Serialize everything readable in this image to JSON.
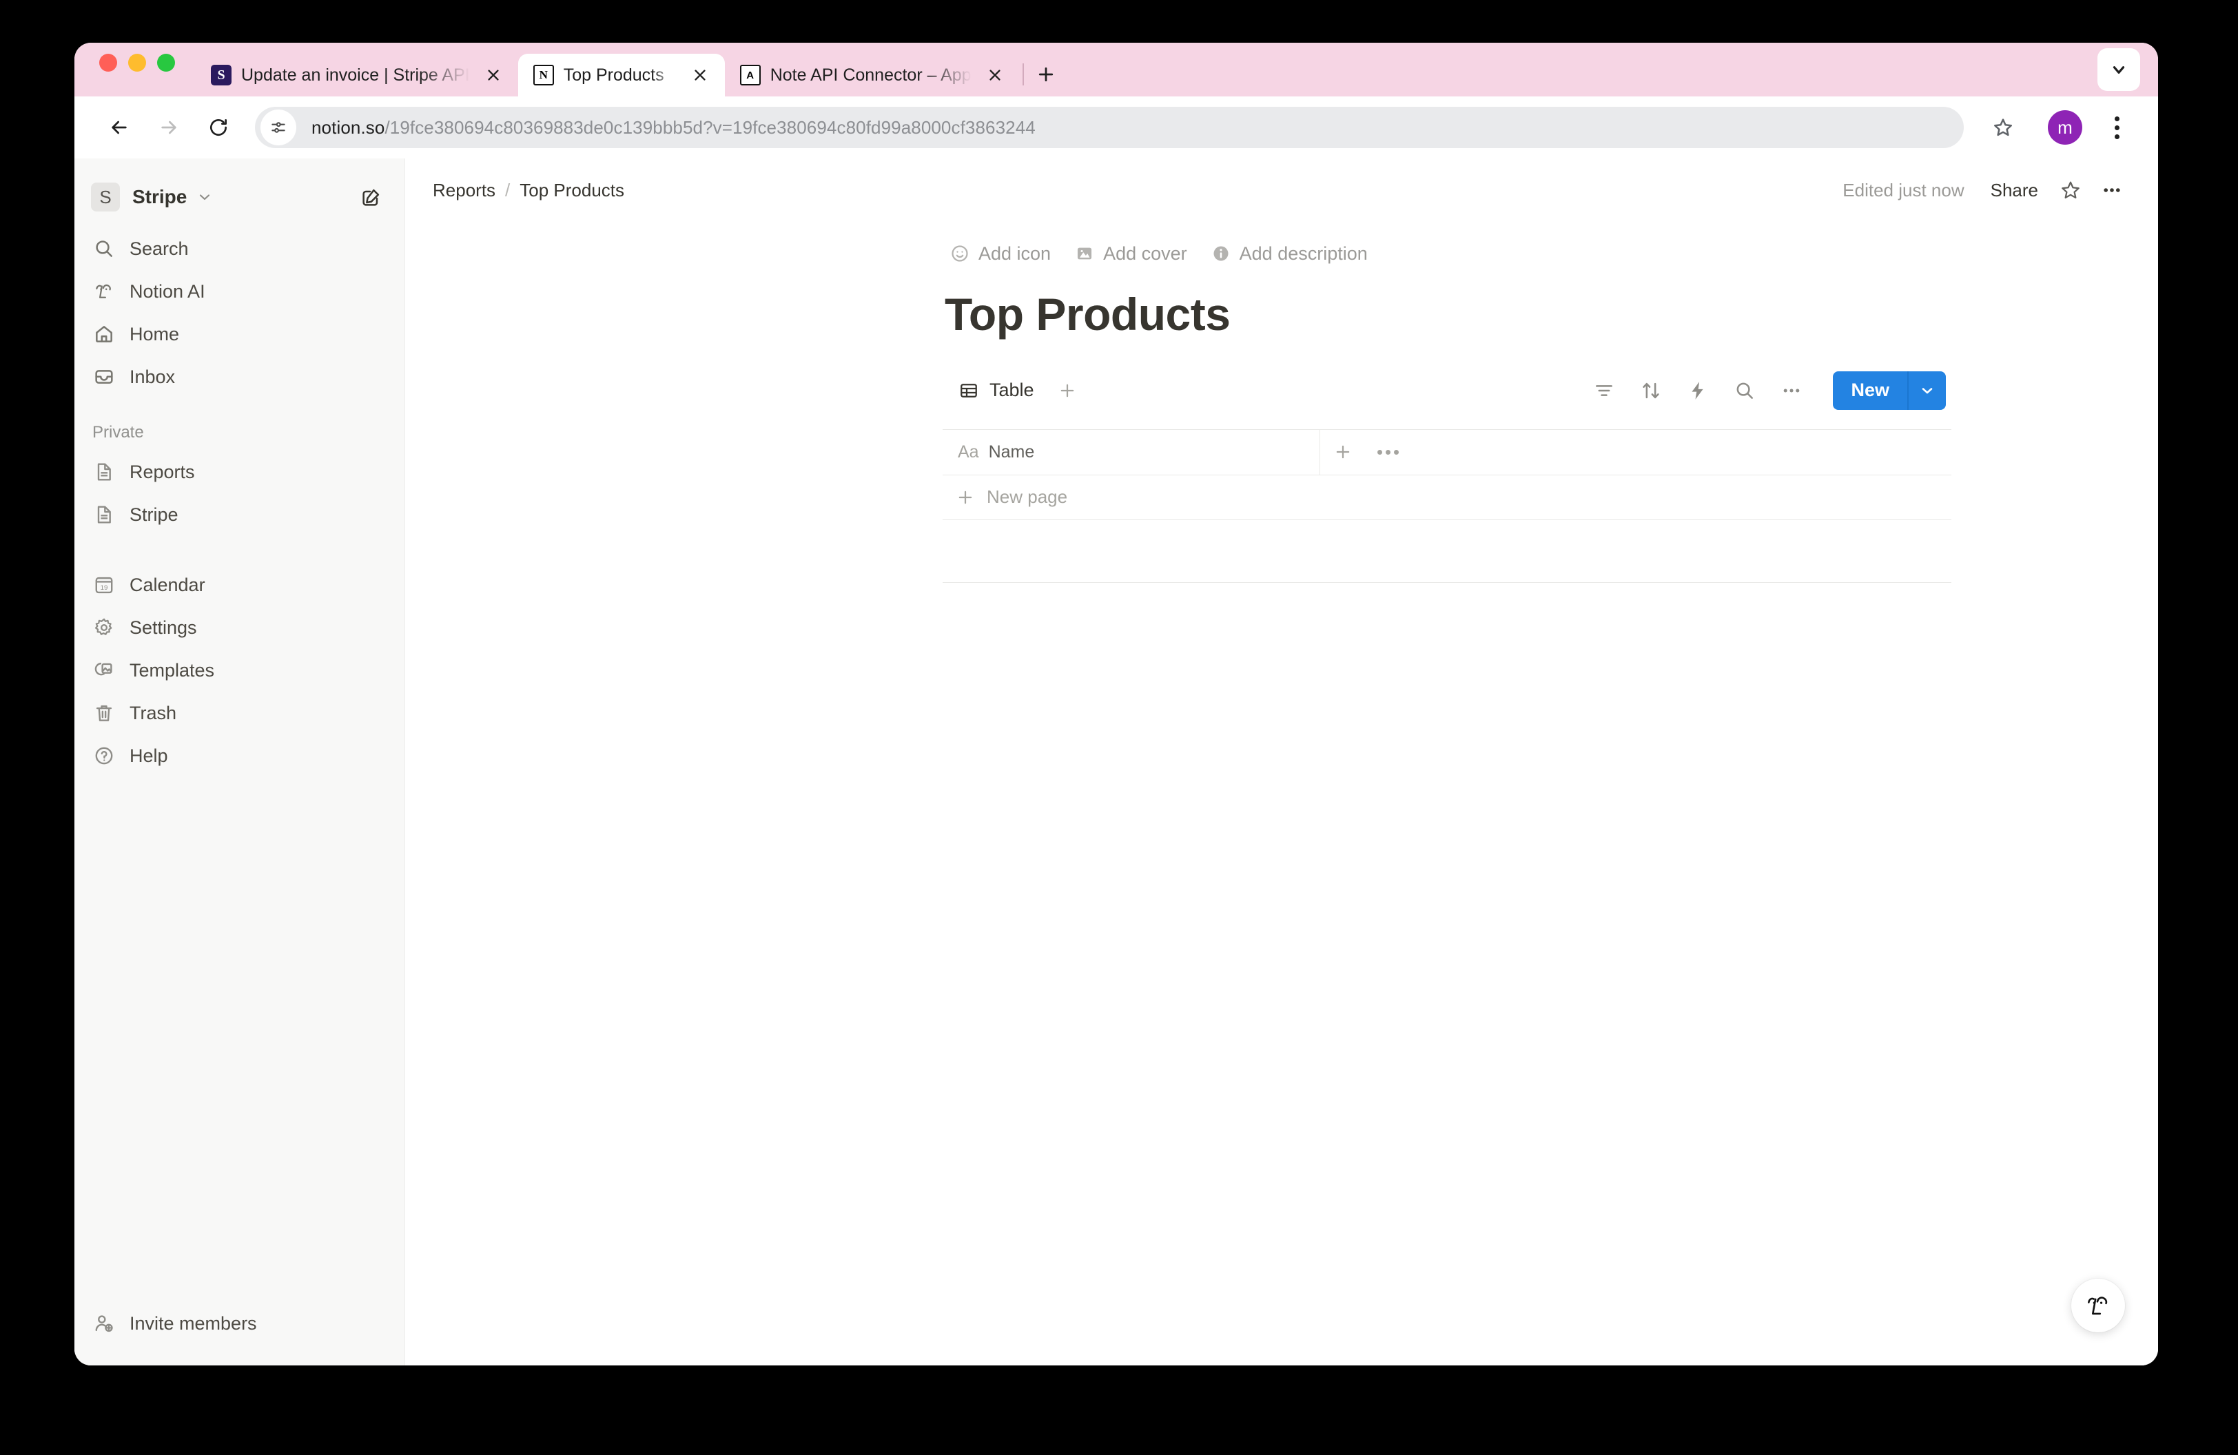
{
  "browser": {
    "tabs": [
      {
        "title": "Update an invoice | Stripe API",
        "favicon": "stripe-favicon",
        "favicon_glyph": "S",
        "active": false
      },
      {
        "title": "Top Products",
        "favicon": "notion-favicon",
        "favicon_glyph": "N",
        "active": true
      },
      {
        "title": "Note API Connector – App",
        "favicon": "app-favicon",
        "favicon_glyph": "A",
        "active": false
      }
    ],
    "new_tab_label": "+",
    "tab_strip_color": "#f6d5e4",
    "url_host": "notion.so",
    "url_path": "/19fce380694c80369883de0c139bbb5d?v=19fce380694c80fd99a8000cf3863244",
    "profile_initial": "m",
    "profile_color": "#8e24b5"
  },
  "sidebar": {
    "workspace": {
      "initial": "S",
      "name": "Stripe"
    },
    "top_items": [
      {
        "label": "Search",
        "icon": "search-icon"
      },
      {
        "label": "Notion AI",
        "icon": "notion-ai-icon"
      },
      {
        "label": "Home",
        "icon": "home-icon"
      },
      {
        "label": "Inbox",
        "icon": "inbox-icon"
      }
    ],
    "private_section_label": "Private",
    "private_items": [
      {
        "label": "Reports",
        "icon": "page-icon"
      },
      {
        "label": "Stripe",
        "icon": "page-icon"
      }
    ],
    "utility_items": [
      {
        "label": "Calendar",
        "icon": "calendar-icon",
        "icon_text": "19"
      },
      {
        "label": "Settings",
        "icon": "gear-icon"
      },
      {
        "label": "Templates",
        "icon": "templates-icon"
      },
      {
        "label": "Trash",
        "icon": "trash-icon"
      },
      {
        "label": "Help",
        "icon": "help-icon"
      }
    ],
    "invite_members_label": "Invite members"
  },
  "page": {
    "breadcrumb": {
      "parent": "Reports",
      "separator": "/",
      "current": "Top Products"
    },
    "edited_status": "Edited just now",
    "share_label": "Share",
    "title": "Top Products",
    "controls": [
      {
        "label": "Add icon",
        "icon": "emoji-icon"
      },
      {
        "label": "Add cover",
        "icon": "image-icon"
      },
      {
        "label": "Add description",
        "icon": "info-icon"
      }
    ]
  },
  "database": {
    "views": [
      {
        "label": "Table",
        "icon": "table-icon",
        "active": true
      }
    ],
    "toolbar_icons": [
      {
        "name": "filter-icon"
      },
      {
        "name": "sort-icon"
      },
      {
        "name": "automation-icon"
      },
      {
        "name": "search-icon"
      },
      {
        "name": "more-icon"
      }
    ],
    "new_button_label": "New",
    "new_button_color": "#2383e2",
    "columns": [
      {
        "type_code": "Aa",
        "label": "Name"
      }
    ],
    "rows": [],
    "new_row_label": "New page"
  }
}
